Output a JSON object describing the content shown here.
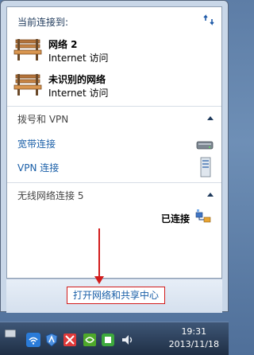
{
  "current": {
    "title": "当前连接到:"
  },
  "connections": [
    {
      "name": "网络  2",
      "access": "Internet 访问"
    },
    {
      "name": "未识别的网络",
      "access": "Internet 访问"
    }
  ],
  "groups": {
    "dialup_vpn": {
      "title": "拨号和 VPN",
      "items": [
        {
          "label": "宽带连接",
          "icon": "modem-icon"
        },
        {
          "label": "VPN 连接",
          "icon": "server-icon"
        }
      ]
    },
    "wireless": {
      "title": "无线网络连接 5",
      "status": "已连接"
    }
  },
  "footer": {
    "open_center": "打开网络和共享中心"
  },
  "taskbar": {
    "time": "19:31",
    "date": "2013/11/18"
  },
  "colors": {
    "link": "#1a5fa8",
    "highlight_border": "#d21c1c",
    "title": "#1e395b"
  }
}
